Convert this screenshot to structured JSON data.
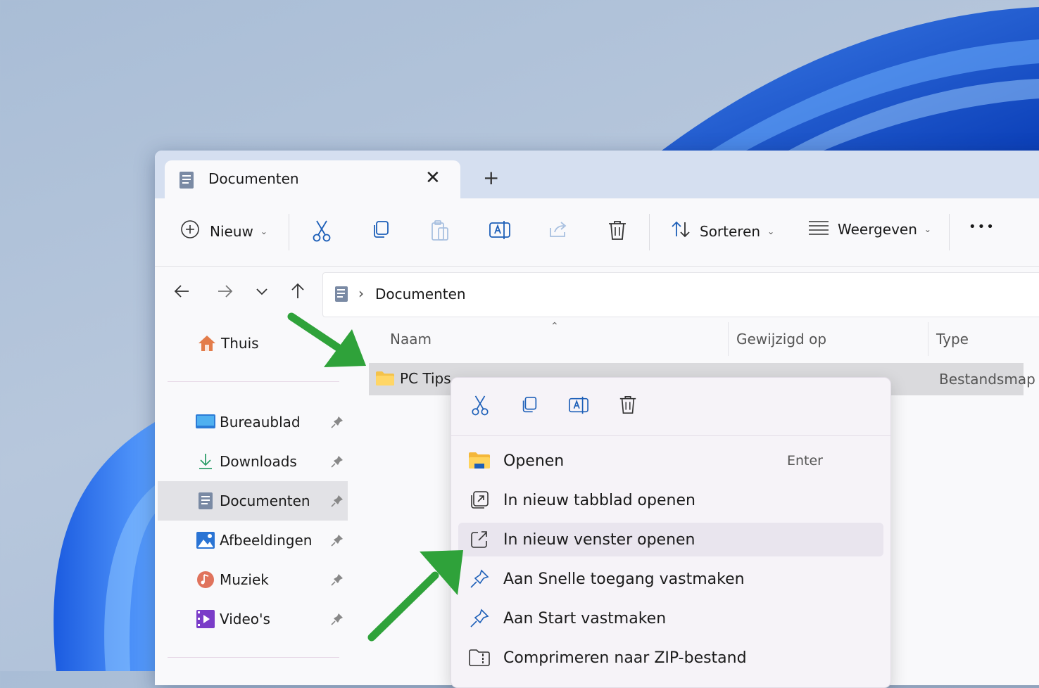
{
  "tab": {
    "title": "Documenten",
    "close": "✕",
    "new_tab": "+"
  },
  "toolbar": {
    "new_label": "Nieuw",
    "sort_label": "Sorteren",
    "view_label": "Weergeven",
    "more": "•••"
  },
  "address": {
    "separator": "›",
    "location": "Documenten"
  },
  "sidebar": {
    "home": "Thuis",
    "items": [
      {
        "label": "Bureaublad"
      },
      {
        "label": "Downloads"
      },
      {
        "label": "Documenten"
      },
      {
        "label": "Afbeeldingen"
      },
      {
        "label": "Muziek"
      },
      {
        "label": "Video's"
      }
    ]
  },
  "columns": {
    "name": "Naam",
    "modified": "Gewijzigd op",
    "type": "Type"
  },
  "file": {
    "name": "PC Tips",
    "type": "Bestandsmap"
  },
  "context_menu": {
    "items": [
      {
        "label": "Openen",
        "shortcut": "Enter"
      },
      {
        "label": "In nieuw tabblad openen"
      },
      {
        "label": "In nieuw venster openen"
      },
      {
        "label": "Aan Snelle toegang vastmaken"
      },
      {
        "label": "Aan Start vastmaken"
      },
      {
        "label": "Comprimeren naar ZIP-bestand"
      }
    ]
  },
  "colors": {
    "accent": "#0067c0",
    "arrow": "#2fa23a",
    "selection": "#dadadd"
  }
}
